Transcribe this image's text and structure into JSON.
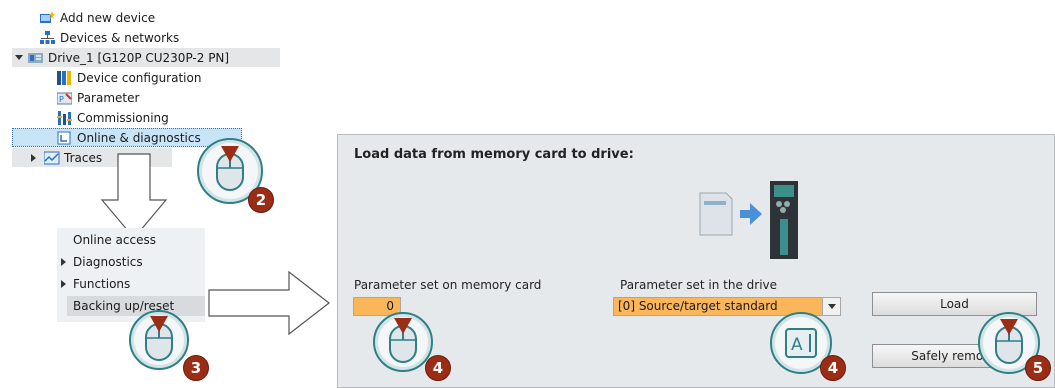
{
  "tree": {
    "items": [
      {
        "label": "Add new device",
        "icon": "add-device-icon"
      },
      {
        "label": "Devices & networks",
        "icon": "network-icon"
      },
      {
        "label": "Drive_1 [G120P CU230P-2 PN]",
        "icon": "drive-icon"
      },
      {
        "label": "Device configuration",
        "icon": "device-config-icon"
      },
      {
        "label": "Parameter",
        "icon": "parameter-icon"
      },
      {
        "label": "Commissioning",
        "icon": "commissioning-icon"
      },
      {
        "label": "Online & diagnostics",
        "icon": "online-diagnostics-icon"
      },
      {
        "label": "Traces",
        "icon": "traces-icon"
      }
    ]
  },
  "context_menu": {
    "items": [
      {
        "label": "Online access"
      },
      {
        "label": "Diagnostics"
      },
      {
        "label": "Functions"
      },
      {
        "label": "Backing up/reset"
      }
    ]
  },
  "dialog": {
    "title": "Load data from memory card to drive:",
    "memory_card_label": "Parameter set on memory card",
    "memory_card_value": "0",
    "drive_label": "Parameter set in the drive",
    "drive_value": "[0] Source/target standard",
    "load_button": "Load",
    "safely_remove_button": "Safely remove"
  },
  "steps": {
    "s2": "2",
    "s3": "3",
    "s4a": "4",
    "s4b": "4",
    "s5": "5"
  },
  "colors": {
    "highlight_field": "#fbb65a",
    "selected_row": "#c9e3f7",
    "badge": "#9b2d16",
    "callout_ring": "#2f7f86"
  }
}
